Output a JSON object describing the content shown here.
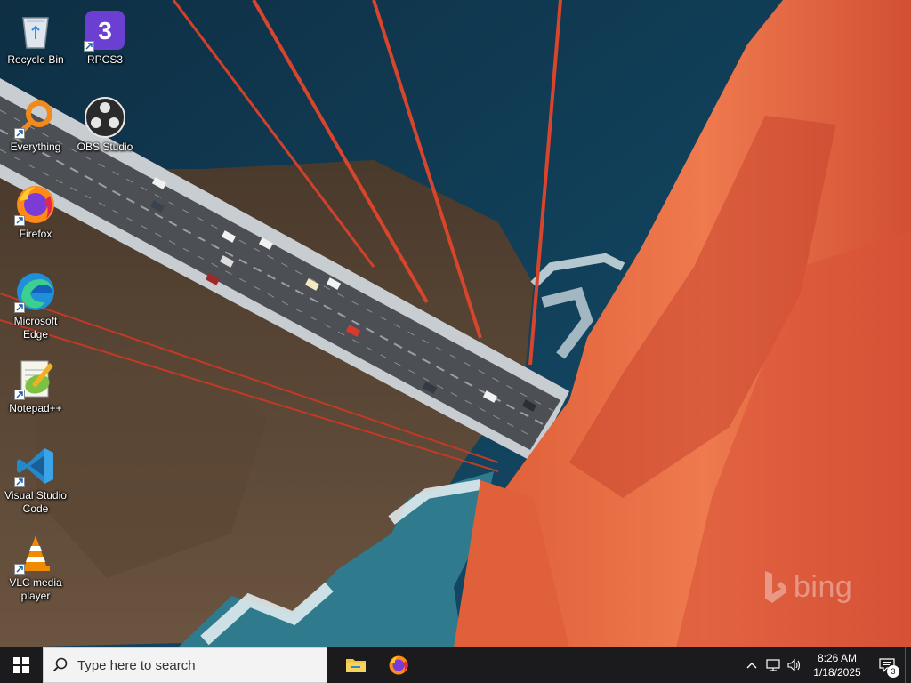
{
  "desktop": {
    "icons": [
      {
        "label": "Recycle Bin",
        "icon": "recycle-bin-icon"
      },
      {
        "label": "RPCS3",
        "icon": "rpcs3-icon"
      },
      {
        "label": "Everything",
        "icon": "everything-search-icon"
      },
      {
        "label": "OBS Studio",
        "icon": "obs-studio-icon"
      },
      {
        "label": "Firefox",
        "icon": "firefox-icon"
      },
      {
        "label": "Microsoft Edge",
        "icon": "edge-icon"
      },
      {
        "label": "Notepad++",
        "icon": "notepadpp-icon"
      },
      {
        "label": "Visual Studio Code",
        "icon": "vscode-icon"
      },
      {
        "label": "VLC media player",
        "icon": "vlc-icon"
      }
    ],
    "watermark": "bing"
  },
  "taskbar": {
    "search_placeholder": "Type here to search",
    "pinned": [
      "file-explorer-icon",
      "firefox-icon"
    ],
    "clock": {
      "time": "8:26 AM",
      "date": "1/18/2025"
    },
    "notification_count": "3"
  },
  "colors": {
    "taskbar_bg": "#1b1b1d",
    "bridge_orange": "#e8643c",
    "ocean": "#0f3a55"
  }
}
